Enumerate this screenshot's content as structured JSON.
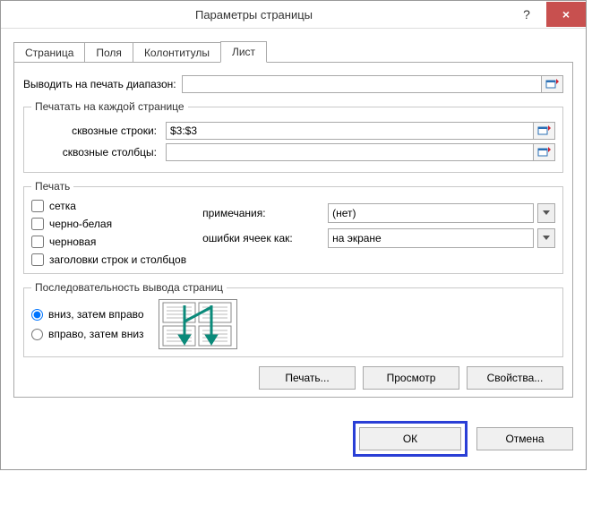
{
  "titlebar": {
    "title": "Параметры страницы",
    "help": "?",
    "close": "×"
  },
  "tabs": {
    "t0": "Страница",
    "t1": "Поля",
    "t2": "Колонтитулы",
    "t3": "Лист",
    "active": 3
  },
  "print_area": {
    "label": "Выводить на печать диапазон:",
    "value": ""
  },
  "repeat": {
    "legend": "Печатать на каждой странице",
    "rows_label": "сквозные строки:",
    "rows_value": "$3:$3",
    "cols_label": "сквозные столбцы:",
    "cols_value": ""
  },
  "print": {
    "legend": "Печать",
    "grid": "сетка",
    "bw": "черно-белая",
    "draft": "черновая",
    "headers": "заголовки строк и столбцов",
    "comments_label": "примечания:",
    "comments_value": "(нет)",
    "errors_label": "ошибки ячеек как:",
    "errors_value": "на экране"
  },
  "order": {
    "legend": "Последовательность вывода страниц",
    "down": "вниз, затем вправо",
    "over": "вправо, затем вниз",
    "selected": "down"
  },
  "buttons": {
    "print": "Печать...",
    "preview": "Просмотр",
    "options": "Свойства...",
    "ok": "ОК",
    "cancel": "Отмена",
    "print_accel": "ч",
    "preview_accel": "с",
    "options_accel": "й",
    "down_accel": "в",
    "over_accel": "п",
    "grid_accel": "с",
    "bw_accel": "ч",
    "draft_accel": "я",
    "headers_accel": "з",
    "rows_accel": "с",
    "cols_accel": "б"
  }
}
